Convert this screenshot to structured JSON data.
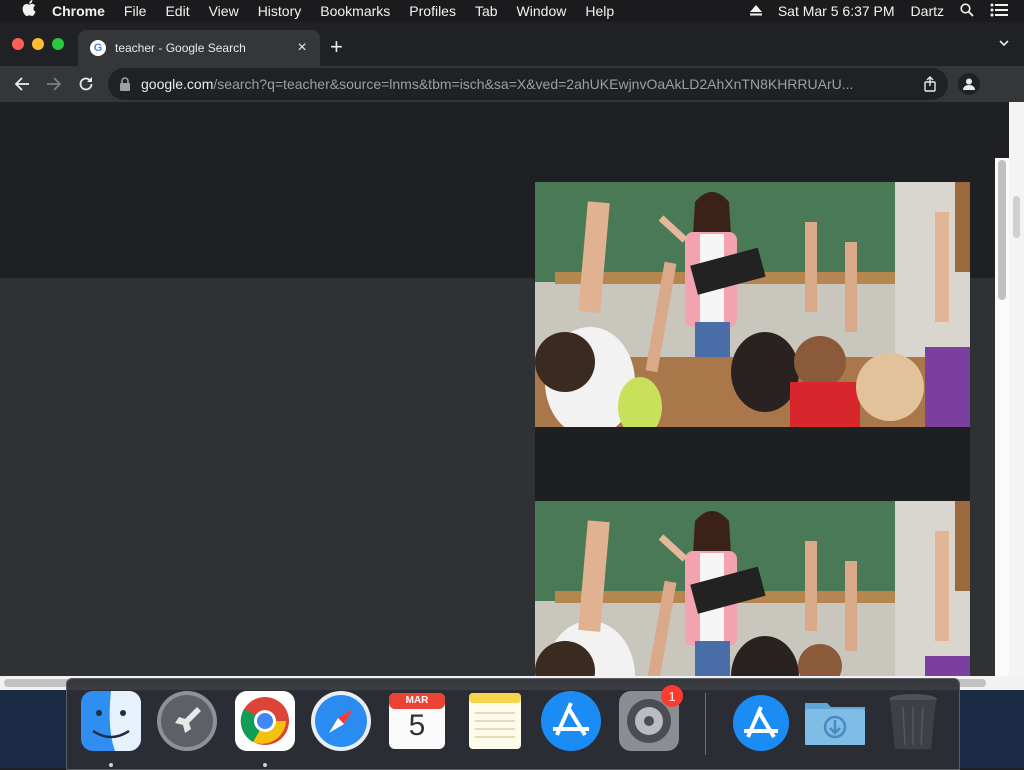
{
  "menubar": {
    "app_name": "Chrome",
    "items": [
      "File",
      "Edit",
      "View",
      "History",
      "Bookmarks",
      "Profiles",
      "Tab",
      "Window",
      "Help"
    ],
    "datetime": "Sat Mar 5  6:37 PM",
    "user": "Dartz"
  },
  "tab": {
    "title": "teacher - Google Search",
    "favicon_letter": "G",
    "close_glyph": "×"
  },
  "new_tab_glyph": "+",
  "toolbar": {
    "url_host": "google.com",
    "url_path": "/search?q=teacher&source=lnms&tbm=isch&sa=X&ved=2ahUKEwjnvOaAkLD2AhXnTN8KHRRUArU..."
  },
  "dock": {
    "calendar_month": "MAR",
    "calendar_day": "5",
    "system_prefs_badge": "1"
  },
  "colors": {
    "accent_blue": "#4285f4",
    "page_dark": "#303134",
    "chalkboard": "#3f6b4a"
  }
}
